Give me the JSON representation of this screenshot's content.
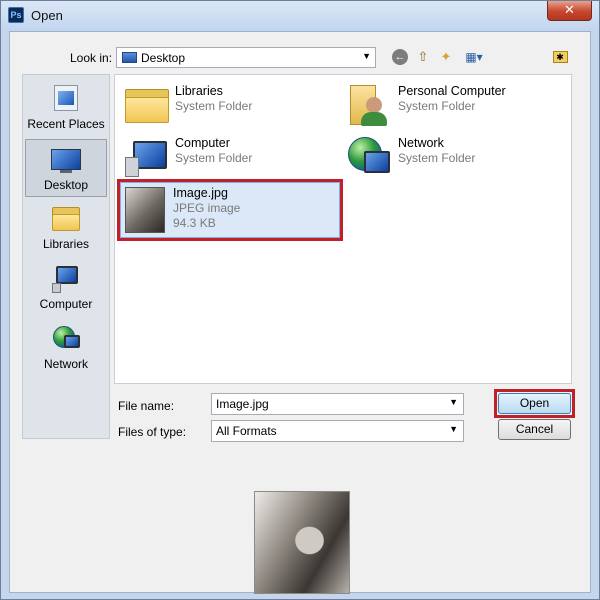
{
  "window": {
    "title": "Open",
    "app_icon_text": "Ps",
    "close_symbol": "✕"
  },
  "toolbar": {
    "look_in_label": "Look in:",
    "look_in_value": "Desktop",
    "back_icon": "←",
    "up_icon": "⇧",
    "new_folder_icon": "✦",
    "views_icon": "▦▾",
    "extra_icon": "✱"
  },
  "places": [
    {
      "label": "Recent Places",
      "icon": "recent-places-icon"
    },
    {
      "label": "Desktop",
      "icon": "desktop-icon",
      "selected": true
    },
    {
      "label": "Libraries",
      "icon": "libraries-icon"
    },
    {
      "label": "Computer",
      "icon": "computer-icon"
    },
    {
      "label": "Network",
      "icon": "network-icon"
    }
  ],
  "files": [
    {
      "name": "Libraries",
      "type": "System Folder",
      "icon": "libraries-folder-icon"
    },
    {
      "name": "Personal Computer",
      "type": "System Folder",
      "icon": "user-folder-icon"
    },
    {
      "name": "Computer",
      "type": "System Folder",
      "icon": "computer-icon"
    },
    {
      "name": "Network",
      "type": "System Folder",
      "icon": "network-icon"
    },
    {
      "name": "Image.jpg",
      "type": "JPEG image",
      "size": "94.3 KB",
      "icon": "image-thumbnail",
      "selected": true
    }
  ],
  "form": {
    "file_name_label": "File name:",
    "file_name_value": "Image.jpg",
    "files_of_type_label": "Files of type:",
    "files_of_type_value": "All Formats",
    "open_label": "Open",
    "cancel_label": "Cancel"
  },
  "colors": {
    "highlight_red": "#c0202a",
    "selection_blue": "#dbe8f7"
  }
}
